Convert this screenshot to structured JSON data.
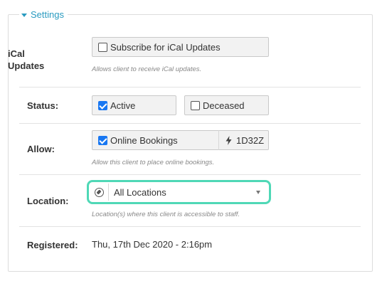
{
  "settings": {
    "legend": "Settings",
    "ical": {
      "label_line1": "iCal",
      "label_line2": "Updates",
      "checkbox_label": "Subscribe for iCal Updates",
      "checked": false,
      "help": "Allows client to receive iCal updates."
    },
    "status": {
      "label": "Status:",
      "active_label": "Active",
      "active_checked": true,
      "deceased_label": "Deceased",
      "deceased_checked": false
    },
    "allow": {
      "label": "Allow:",
      "online_bookings_label": "Online Bookings",
      "online_bookings_checked": true,
      "code": "1D32Z",
      "help": "Allow this client to place online bookings."
    },
    "location": {
      "label": "Location:",
      "selected": "All Locations",
      "help": "Location(s) where this client is accessible to staff."
    },
    "registered": {
      "label": "Registered:",
      "value": "Thu, 17th Dec 2020 - 2:16pm"
    }
  },
  "colors": {
    "accent": "#2a9bc0",
    "checkbox_on": "#1877f2",
    "focus_ring": "#4fd8b6"
  }
}
